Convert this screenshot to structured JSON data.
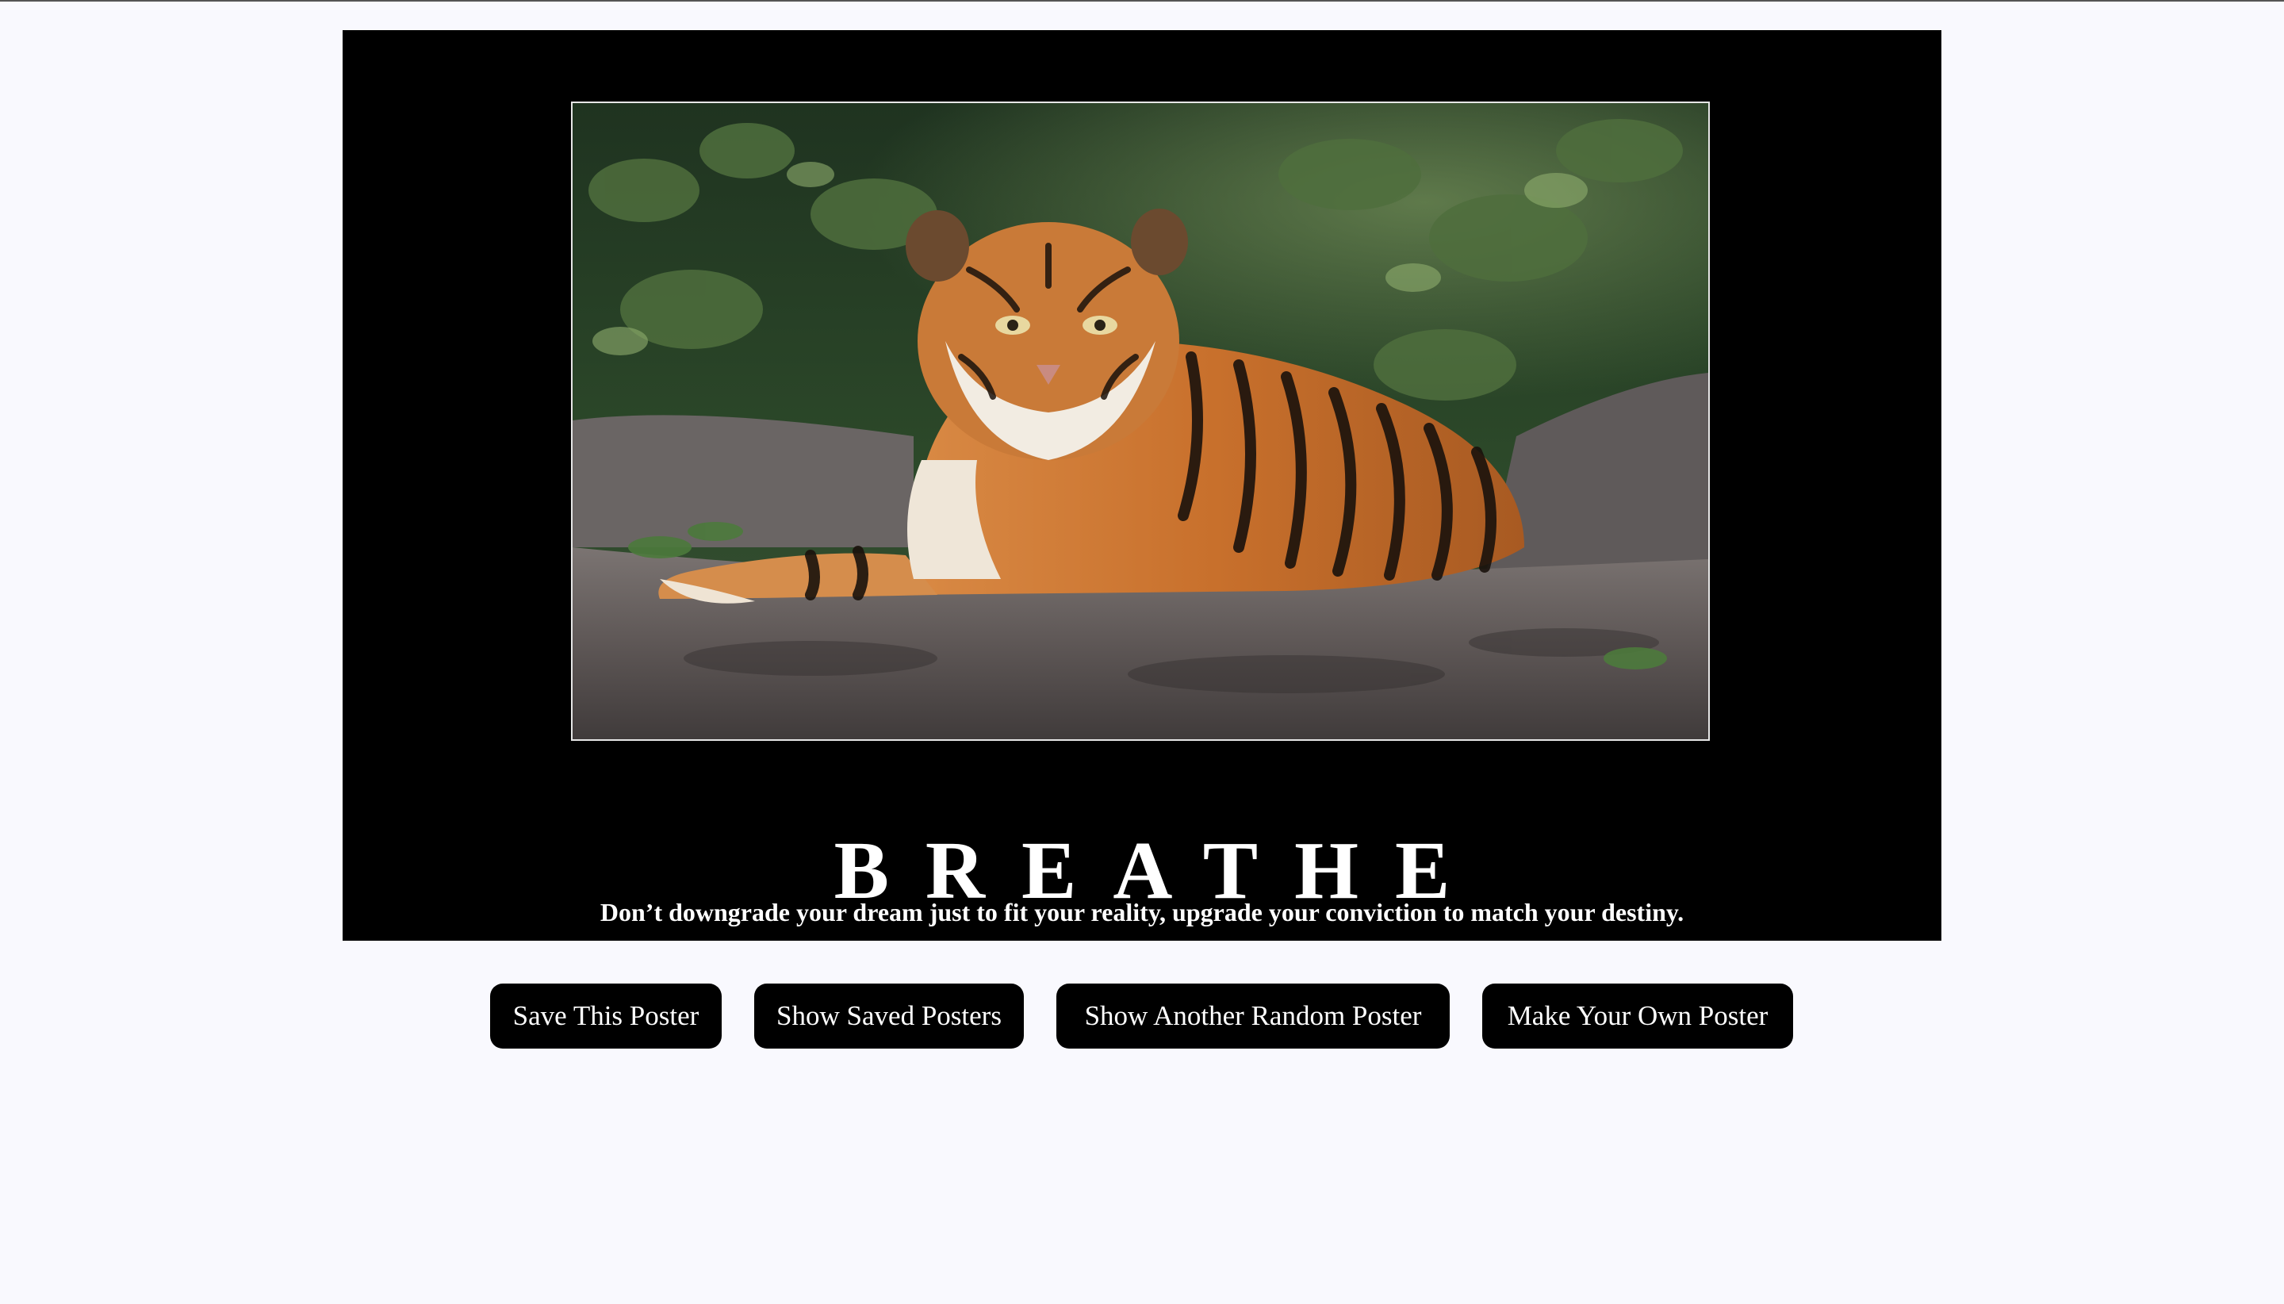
{
  "poster": {
    "image_alt": "tiger resting on a rock",
    "title": "BREATHE",
    "quote": "Don’t downgrade your dream just to fit your reality, upgrade your conviction to match your destiny."
  },
  "buttons": {
    "save": "Save This Poster",
    "show_saved": "Show Saved Posters",
    "random": "Show Another Random Poster",
    "make_own": "Make Your Own Poster"
  },
  "colors": {
    "page_bg": "#f9f9fe",
    "poster_bg": "#000000",
    "button_bg": "#000000",
    "button_text": "#ffffff",
    "text": "#ffffff"
  }
}
